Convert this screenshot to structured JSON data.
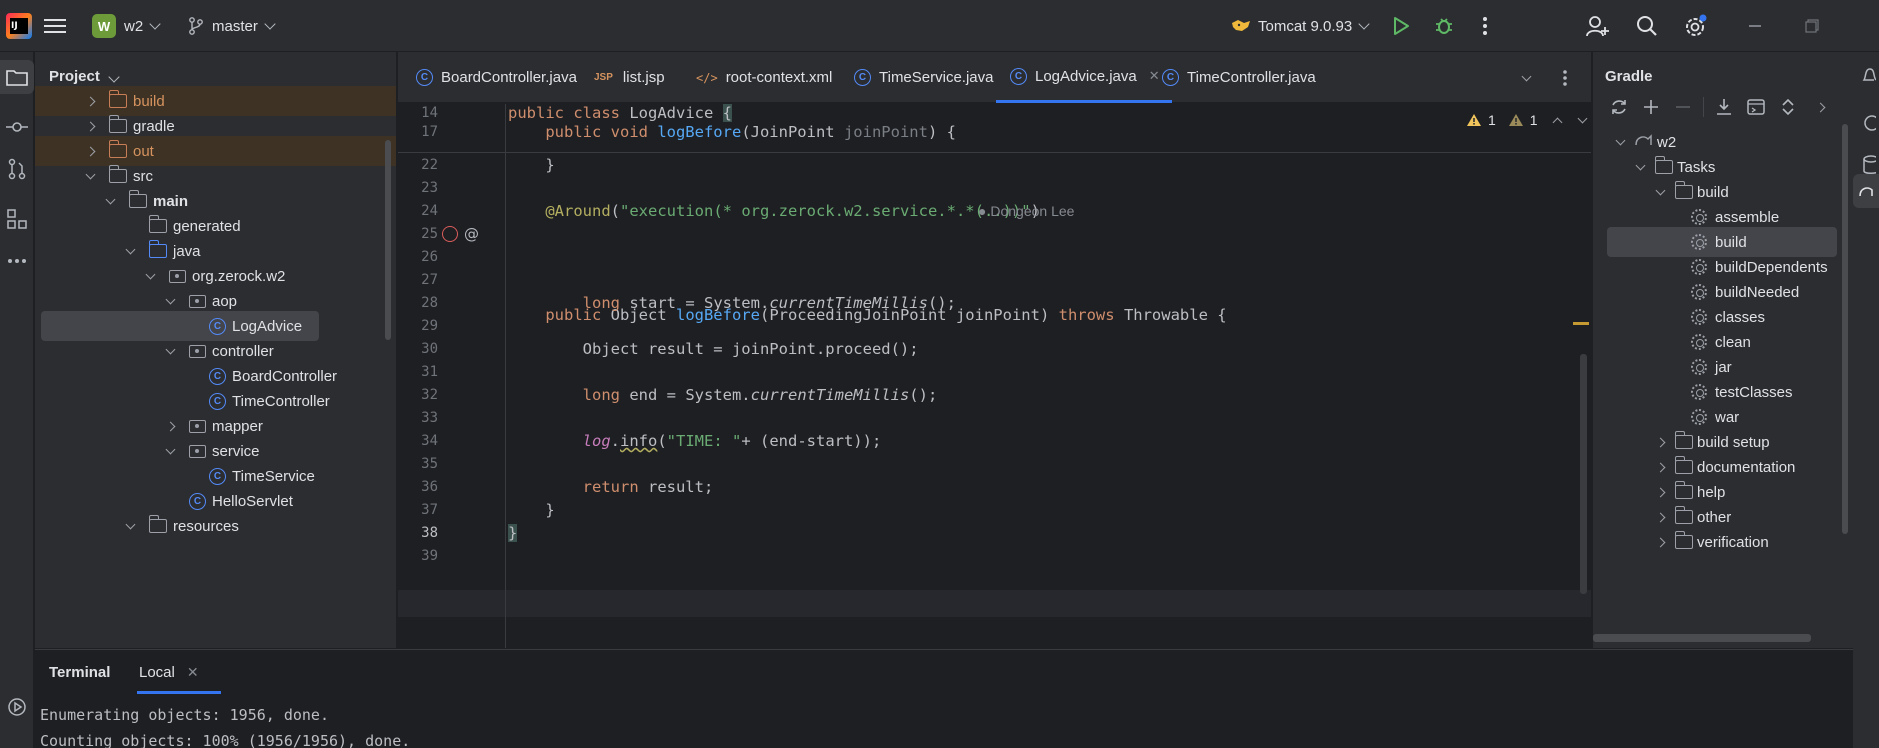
{
  "titlebar": {
    "project_letter": "W",
    "project_name": "w2",
    "branch": "master",
    "run_config": "Tomcat 9.0.93"
  },
  "project_panel": {
    "title": "Project",
    "tree": [
      {
        "label": "build",
        "type": "folder-orange",
        "depth": 1,
        "expand": "collapsed",
        "highlight": true
      },
      {
        "label": "gradle",
        "type": "folder",
        "depth": 1,
        "expand": "collapsed"
      },
      {
        "label": "out",
        "type": "folder-orange",
        "depth": 1,
        "expand": "collapsed",
        "highlight": true
      },
      {
        "label": "src",
        "type": "folder",
        "depth": 1,
        "expand": "expanded"
      },
      {
        "label": "main",
        "type": "folder",
        "depth": 2,
        "expand": "expanded",
        "bold": true
      },
      {
        "label": "generated",
        "type": "folder",
        "depth": 3,
        "expand": "none"
      },
      {
        "label": "java",
        "type": "folder-blue",
        "depth": 3,
        "expand": "expanded"
      },
      {
        "label": "org.zerock.w2",
        "type": "package",
        "depth": 4,
        "expand": "expanded"
      },
      {
        "label": "aop",
        "type": "package",
        "depth": 5,
        "expand": "expanded"
      },
      {
        "label": "LogAdvice",
        "type": "class",
        "depth": 6,
        "expand": "none",
        "selected": true
      },
      {
        "label": "controller",
        "type": "package",
        "depth": 5,
        "expand": "expanded"
      },
      {
        "label": "BoardController",
        "type": "class",
        "depth": 6,
        "expand": "none"
      },
      {
        "label": "TimeController",
        "type": "class",
        "depth": 6,
        "expand": "none"
      },
      {
        "label": "mapper",
        "type": "package",
        "depth": 5,
        "expand": "collapsed"
      },
      {
        "label": "service",
        "type": "package",
        "depth": 5,
        "expand": "expanded"
      },
      {
        "label": "TimeService",
        "type": "class",
        "depth": 6,
        "expand": "none"
      },
      {
        "label": "HelloServlet",
        "type": "class",
        "depth": 5,
        "expand": "none"
      },
      {
        "label": "resources",
        "type": "folder",
        "depth": 3,
        "expand": "expanded"
      }
    ]
  },
  "editor_tabs": [
    {
      "label": "BoardController.java",
      "icon": "class-icon"
    },
    {
      "label": "list.jsp",
      "icon": "jsp-icon"
    },
    {
      "label": "root-context.xml",
      "icon": "xml-icon"
    },
    {
      "label": "TimeService.java",
      "icon": "class-icon"
    },
    {
      "label": "LogAdvice.java",
      "icon": "class-icon",
      "active": true
    },
    {
      "label": "TimeController.java",
      "icon": "class-icon"
    }
  ],
  "inspection": {
    "warnings": "1",
    "weak_warnings": "1"
  },
  "code": {
    "line14": "14",
    "line17": "17",
    "line22": "22",
    "line23": "23",
    "line24": "24",
    "line25": "25",
    "line26": "26",
    "line27": "27",
    "line28": "28",
    "line29": "29",
    "line30": "30",
    "line31": "31",
    "line32": "32",
    "line33": "33",
    "line34": "34",
    "line35": "35",
    "line36": "36",
    "line37": "37",
    "line38": "38",
    "line39": "39",
    "author": "Dongeon Lee",
    "pointcut": "\"execution(* org.zerock.w2.service.*.*(..))\"",
    "log_string": "\"TIME: \""
  },
  "gradle_panel": {
    "title": "Gradle",
    "tree": [
      {
        "label": "w2",
        "depth": 0,
        "expand": "expanded",
        "icon": "gradle-icon"
      },
      {
        "label": "Tasks",
        "depth": 1,
        "expand": "expanded",
        "icon": "folder-gear-icon"
      },
      {
        "label": "build",
        "depth": 2,
        "expand": "expanded",
        "icon": "folder-gear-icon"
      },
      {
        "label": "assemble",
        "depth": 3,
        "expand": "none",
        "icon": "gear-icon"
      },
      {
        "label": "build",
        "depth": 3,
        "expand": "none",
        "icon": "gear-icon",
        "selected": true
      },
      {
        "label": "buildDependents",
        "depth": 3,
        "expand": "none",
        "icon": "gear-icon"
      },
      {
        "label": "buildNeeded",
        "depth": 3,
        "expand": "none",
        "icon": "gear-icon"
      },
      {
        "label": "classes",
        "depth": 3,
        "expand": "none",
        "icon": "gear-icon"
      },
      {
        "label": "clean",
        "depth": 3,
        "expand": "none",
        "icon": "gear-icon"
      },
      {
        "label": "jar",
        "depth": 3,
        "expand": "none",
        "icon": "gear-icon"
      },
      {
        "label": "testClasses",
        "depth": 3,
        "expand": "none",
        "icon": "gear-icon"
      },
      {
        "label": "war",
        "depth": 3,
        "expand": "none",
        "icon": "gear-icon"
      },
      {
        "label": "build setup",
        "depth": 2,
        "expand": "collapsed",
        "icon": "folder-gear-icon"
      },
      {
        "label": "documentation",
        "depth": 2,
        "expand": "collapsed",
        "icon": "folder-gear-icon"
      },
      {
        "label": "help",
        "depth": 2,
        "expand": "collapsed",
        "icon": "folder-gear-icon"
      },
      {
        "label": "other",
        "depth": 2,
        "expand": "collapsed",
        "icon": "folder-gear-icon"
      },
      {
        "label": "verification",
        "depth": 2,
        "expand": "collapsed",
        "icon": "folder-gear-icon"
      }
    ]
  },
  "terminal": {
    "title": "Terminal",
    "tab": "Local",
    "lines": [
      "Enumerating objects: 1956, done.",
      "Counting objects: 100% (1956/1956), done."
    ]
  }
}
